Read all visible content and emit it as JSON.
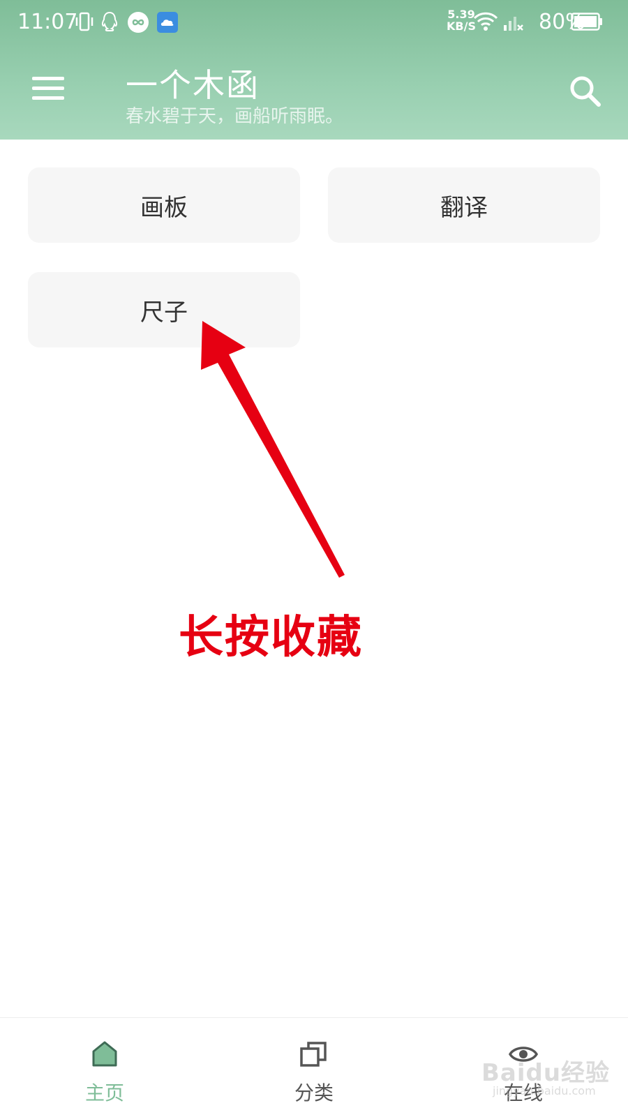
{
  "status_bar": {
    "time": "11:07",
    "net_speed_value": "5.39",
    "net_speed_unit": "KB/S",
    "battery": "80%",
    "icons": [
      "vibrate-icon",
      "qq-icon",
      "infinity-app-icon",
      "cloud-app-icon",
      "wifi-icon",
      "signal-icon",
      "battery-icon"
    ]
  },
  "header": {
    "title": "一个木函",
    "subtitle": "春水碧于天，画船听雨眠。",
    "menu_icon": "hamburger-menu-icon",
    "search_icon": "search-icon"
  },
  "tiles": [
    {
      "label": "画板"
    },
    {
      "label": "翻译"
    },
    {
      "label": "尺子"
    }
  ],
  "annotation": {
    "text": "长按收藏",
    "color": "#e60012"
  },
  "bottom_nav": {
    "items": [
      {
        "label": "主页",
        "icon": "home-icon",
        "active": true
      },
      {
        "label": "分类",
        "icon": "category-icon",
        "active": false
      },
      {
        "label": "在线",
        "icon": "eye-icon",
        "active": false
      }
    ],
    "active_color": "#7fbd98",
    "inactive_color": "#555555"
  },
  "watermark": {
    "text": "Baidu经验",
    "sub": "jingyan.baidu.com"
  },
  "colors": {
    "header_green": "#7fbd98",
    "tile_bg": "#f6f6f6"
  }
}
